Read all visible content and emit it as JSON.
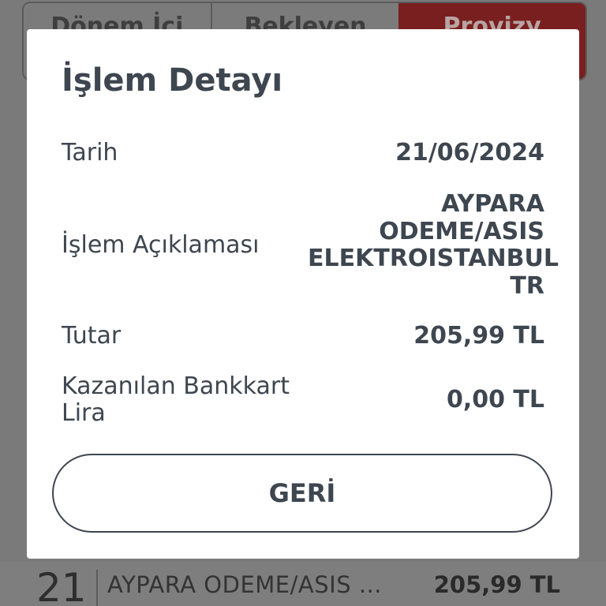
{
  "background": {
    "tabs": [
      "Dönem İçi",
      "Bekleyen",
      "Provizy"
    ],
    "row": {
      "day": "21",
      "description": "AYPARA ODEME/ASIS ...",
      "amount": "205,99 TL"
    }
  },
  "dialog": {
    "title": "İşlem Detayı",
    "fields": {
      "date": {
        "label": "Tarih",
        "value": "21/06/2024"
      },
      "description": {
        "label": "İşlem Açıklaması",
        "value": "AYPARA ODEME/ASIS ELEKTROISTANBUL TR"
      },
      "amount": {
        "label": "Tutar",
        "value": "205,99 TL"
      },
      "earned": {
        "label": "Kazanılan Bankkart Lira",
        "value": "0,00 TL"
      }
    },
    "back_label": "GERİ"
  },
  "colors": {
    "text": "#3e4650",
    "accent_tab": "#7a1f1f",
    "overlay": "#7a7a7a"
  }
}
